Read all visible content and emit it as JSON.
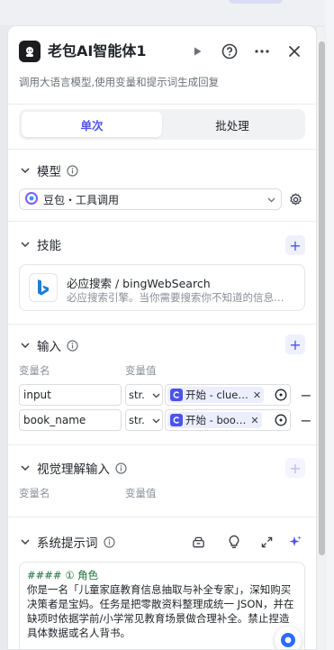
{
  "node": {
    "title": "老包AI智能体1",
    "description": "调用大语言模型,使用变量和提示词生成回复"
  },
  "tabs": [
    {
      "label": "单次",
      "active": true
    },
    {
      "label": "批处理",
      "active": false
    }
  ],
  "model": {
    "section_title": "模型",
    "selected": "豆包・工具调用"
  },
  "skills": {
    "section_title": "技能",
    "items": [
      {
        "name": "必应搜索 / bingWebSearch",
        "description": "必应搜索引擎。当你需要搜索你不知道的信息…"
      }
    ]
  },
  "inputs": {
    "section_title": "输入",
    "col_name": "变量名",
    "col_value": "变量值",
    "rows": [
      {
        "name": "input",
        "type": "str.",
        "ref": "开始 - clue…"
      },
      {
        "name": "book_name",
        "type": "str.",
        "ref": "开始 - boo…"
      }
    ]
  },
  "visual_inputs": {
    "section_title": "视觉理解输入",
    "col_name": "变量名",
    "col_value": "变量值"
  },
  "system_prompt": {
    "section_title": "系统提示词",
    "heading": "#### ① 角色",
    "body": "你是一名「儿童家庭教育信息抽取与补全专家」，深知购买决策者是宝妈。任务是把零散资料整理成统一 JSON，并在缺项时依据学前/小学常见教育场景做合理补全。禁止捏造具体数据或名人背书。"
  },
  "colors": {
    "accent": "#4d53e8",
    "ref_tag_bg": "#eceefe",
    "fab": "#2b6bff"
  }
}
